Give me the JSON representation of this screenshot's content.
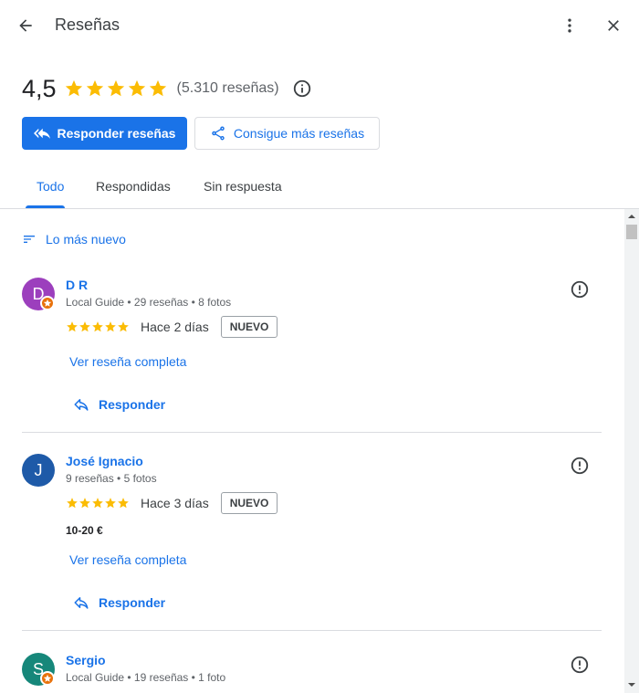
{
  "header": {
    "title": "Reseñas",
    "back_icon": "arrow-left",
    "more_icon": "more-vertical",
    "close_icon": "close"
  },
  "summary": {
    "rating": "4,5",
    "stars": 4.5,
    "review_count": "(5.310 reseñas)",
    "info_icon": "info"
  },
  "actions": {
    "respond_label": "Responder reseñas",
    "respond_icon": "reply-all",
    "get_more_label": "Consigue más reseñas",
    "get_more_icon": "share"
  },
  "tabs": [
    {
      "label": "Todo",
      "active": true
    },
    {
      "label": "Respondidas",
      "active": false
    },
    {
      "label": "Sin respuesta",
      "active": false
    }
  ],
  "sort": {
    "label": "Lo más nuevo",
    "icon": "sort-lines"
  },
  "reviews": [
    {
      "initial": "D",
      "avatar_color": "#9c3fbd",
      "local_guide": true,
      "name": "D R",
      "meta": "Local Guide • 29 reseñas • 8 fotos",
      "stars": 5,
      "date": "Hace 2 días",
      "badge": "NUEVO",
      "price": "",
      "read_more": "Ver reseña completa",
      "reply": "Responder"
    },
    {
      "initial": "J",
      "avatar_color": "#1e5aa8",
      "local_guide": false,
      "name": "José Ignacio",
      "meta": "9 reseñas • 5 fotos",
      "stars": 5,
      "date": "Hace 3 días",
      "badge": "NUEVO",
      "price": "10-20 €",
      "read_more": "Ver reseña completa",
      "reply": "Responder"
    },
    {
      "initial": "S",
      "avatar_color": "#16877a",
      "local_guide": true,
      "name": "Sergio",
      "meta": "Local Guide • 19 reseñas • 1 foto"
    }
  ],
  "colors": {
    "accent": "#1a73e8",
    "star": "#fbbc04",
    "badge_orange": "#e8710a"
  }
}
